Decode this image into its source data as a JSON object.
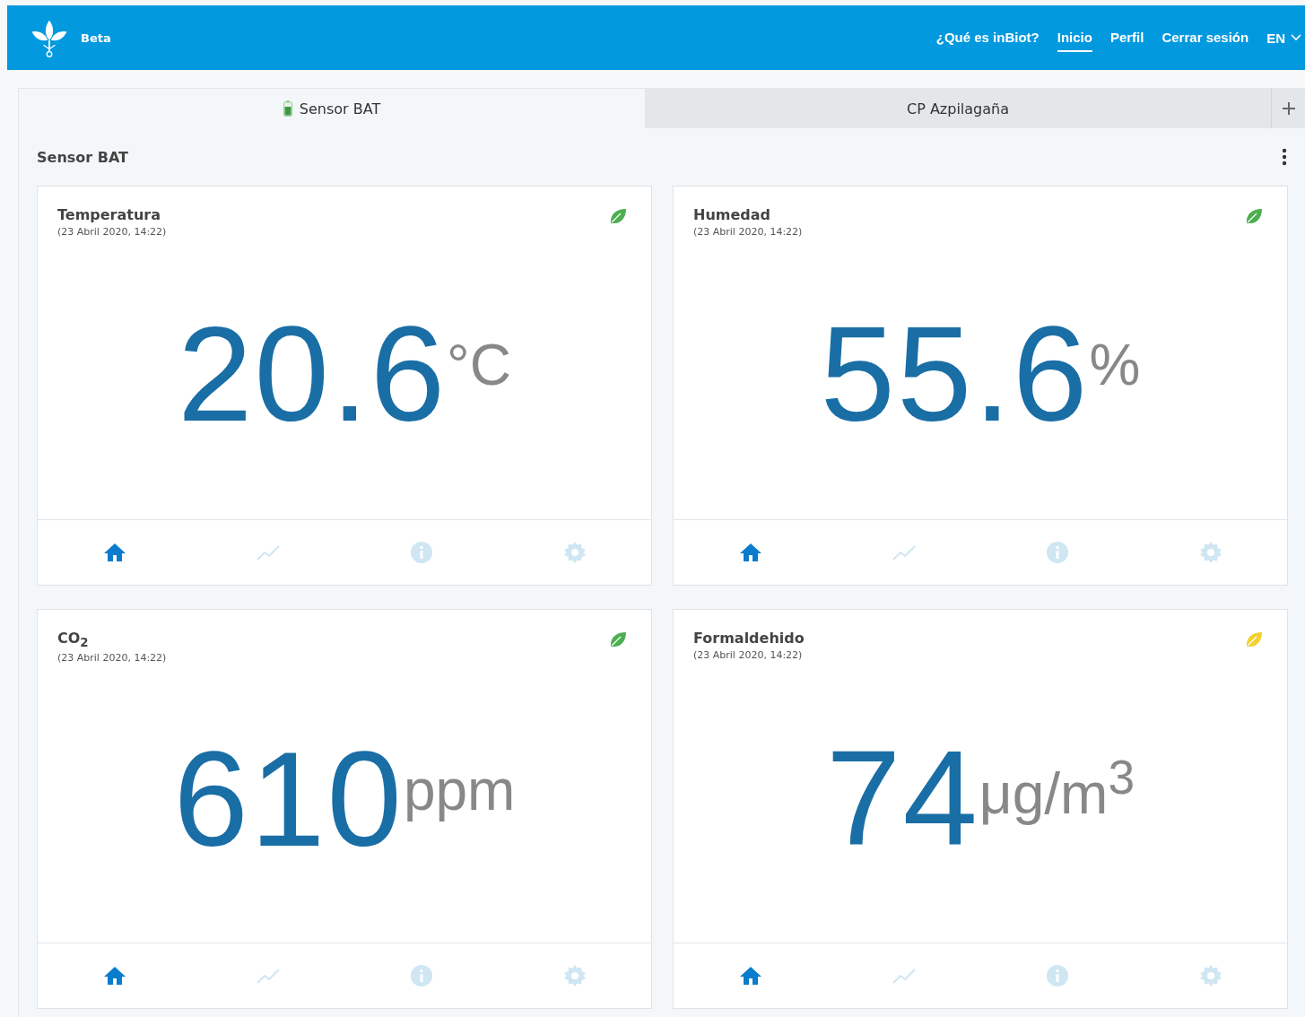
{
  "header": {
    "badge": "Beta",
    "nav": [
      {
        "label": "¿Qué es inBiot?",
        "selected": false
      },
      {
        "label": "Inicio",
        "selected": true
      },
      {
        "label": "Perfil",
        "selected": false
      },
      {
        "label": "Cerrar sesión",
        "selected": false
      }
    ],
    "language": "EN"
  },
  "tabs": [
    {
      "label": "Sensor BAT",
      "selected": true,
      "battery": true
    },
    {
      "label": "CP Azpilagaña",
      "selected": false,
      "battery": false
    }
  ],
  "page_title": "Sensor BAT",
  "cards": [
    {
      "title": "Temperatura",
      "timestamp": "(23 Abril 2020, 14:22)",
      "color": "#4caf50",
      "value": "20.6",
      "unit": "°C",
      "views": [
        {
          "kind": "home",
          "selected": true
        },
        {
          "kind": "chart",
          "selected": false
        },
        {
          "kind": "info",
          "selected": false
        },
        {
          "kind": "settings",
          "selected": false
        }
      ]
    },
    {
      "title": "Humedad",
      "timestamp": "(23 Abril 2020, 14:22)",
      "color": "#4caf50",
      "value": "55.6",
      "unit": "%",
      "views": [
        {
          "kind": "home",
          "selected": true
        },
        {
          "kind": "chart",
          "selected": false
        },
        {
          "kind": "info",
          "selected": false
        },
        {
          "kind": "settings",
          "selected": false
        }
      ]
    },
    {
      "title": "CO$_{2}$",
      "timestamp": "(23 Abril 2020, 14:22)",
      "color": "#4caf50",
      "value": "610",
      "unit": "ppm",
      "views": [
        {
          "kind": "home",
          "selected": true
        },
        {
          "kind": "chart",
          "selected": false
        },
        {
          "kind": "info",
          "selected": false
        },
        {
          "kind": "settings",
          "selected": false
        }
      ]
    },
    {
      "title": "Formaldehido",
      "timestamp": "(23 Abril 2020, 14:22)",
      "color": "#f2d230",
      "value": "74",
      "unit": "μg/m$^{3}$",
      "views": [
        {
          "kind": "home",
          "selected": true
        },
        {
          "kind": "chart",
          "selected": false
        },
        {
          "kind": "info",
          "selected": false
        },
        {
          "kind": "settings",
          "selected": false
        }
      ]
    }
  ]
}
